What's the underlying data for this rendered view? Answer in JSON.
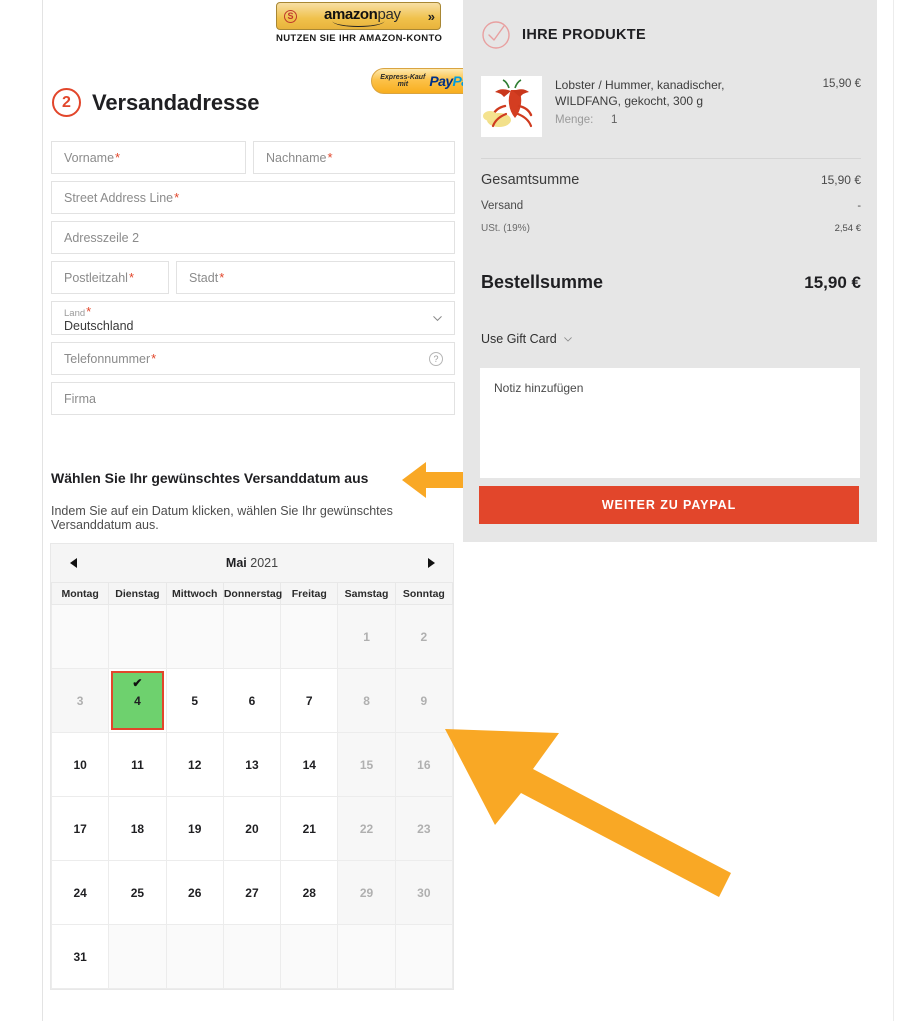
{
  "express": {
    "amazon": {
      "brand_amazon": "amazon",
      "brand_pay": "pay",
      "s_badge": "S",
      "chevron": "»",
      "subtitle": "NUTZEN SIE IHR AMAZON-KONTO"
    },
    "paypal": {
      "line1": "Express-Kauf",
      "line2": "mit",
      "logo_a": "Pay",
      "logo_b": "Pal"
    }
  },
  "step": {
    "number": "2",
    "title": "Versandadresse",
    "accent": "#e2462b"
  },
  "form": {
    "fields": [
      {
        "label": "Vorname",
        "required": true
      },
      {
        "label": "Nachname",
        "required": true
      },
      {
        "label": "Street Address Line",
        "required": true
      },
      {
        "label": "Adresszeile 2",
        "required": false
      },
      {
        "label": "Postleitzahl",
        "required": true
      },
      {
        "label": "Stadt",
        "required": true
      },
      {
        "label": "Telefonnummer",
        "required": true
      },
      {
        "label": "Firma",
        "required": false
      }
    ],
    "country": {
      "label": "Land",
      "required_mark": "*",
      "value": "Deutschland"
    },
    "required_mark": "*",
    "help_glyph": "?"
  },
  "shipping_date": {
    "title": "Wählen Sie Ihr gewünschtes Versanddatum aus",
    "subtitle": "Indem Sie auf ein Datum klicken, wählen Sie Ihr gewünschtes Versanddatum aus."
  },
  "calendar": {
    "month": "Mai",
    "year": "2021",
    "prev_label": "◄",
    "next_label": "►",
    "weekdays": [
      "Montag",
      "Dienstag",
      "Mittwoch",
      "Donnerstag",
      "Freitag",
      "Samstag",
      "Sonntag"
    ],
    "selected_day": "4",
    "selected_check": "✔",
    "selected_bg": "#6ed16e",
    "selected_border": "#e2462b",
    "weeks": [
      [
        {
          "day": "",
          "state": "empty"
        },
        {
          "day": "",
          "state": "empty"
        },
        {
          "day": "",
          "state": "empty"
        },
        {
          "day": "",
          "state": "empty"
        },
        {
          "day": "",
          "state": "empty"
        },
        {
          "day": "1",
          "state": "disabled"
        },
        {
          "day": "2",
          "state": "disabled"
        }
      ],
      [
        {
          "day": "3",
          "state": "disabled"
        },
        {
          "day": "4",
          "state": "selected"
        },
        {
          "day": "5",
          "state": "available"
        },
        {
          "day": "6",
          "state": "available"
        },
        {
          "day": "7",
          "state": "available"
        },
        {
          "day": "8",
          "state": "disabled"
        },
        {
          "day": "9",
          "state": "disabled"
        }
      ],
      [
        {
          "day": "10",
          "state": "available"
        },
        {
          "day": "11",
          "state": "available"
        },
        {
          "day": "12",
          "state": "available"
        },
        {
          "day": "13",
          "state": "available"
        },
        {
          "day": "14",
          "state": "available"
        },
        {
          "day": "15",
          "state": "disabled"
        },
        {
          "day": "16",
          "state": "disabled"
        }
      ],
      [
        {
          "day": "17",
          "state": "available"
        },
        {
          "day": "18",
          "state": "available"
        },
        {
          "day": "19",
          "state": "available"
        },
        {
          "day": "20",
          "state": "available"
        },
        {
          "day": "21",
          "state": "available"
        },
        {
          "day": "22",
          "state": "disabled"
        },
        {
          "day": "23",
          "state": "disabled"
        }
      ],
      [
        {
          "day": "24",
          "state": "available"
        },
        {
          "day": "25",
          "state": "available"
        },
        {
          "day": "26",
          "state": "available"
        },
        {
          "day": "27",
          "state": "available"
        },
        {
          "day": "28",
          "state": "available"
        },
        {
          "day": "29",
          "state": "disabled"
        },
        {
          "day": "30",
          "state": "disabled"
        }
      ],
      [
        {
          "day": "31",
          "state": "available"
        },
        {
          "day": "",
          "state": "empty"
        },
        {
          "day": "",
          "state": "empty"
        },
        {
          "day": "",
          "state": "empty"
        },
        {
          "day": "",
          "state": "empty"
        },
        {
          "day": "",
          "state": "empty"
        },
        {
          "day": "",
          "state": "empty"
        }
      ]
    ]
  },
  "annotations": {
    "arrow_color": "#f9a825",
    "arrow_small_direction": "left",
    "arrow_big_direction": "up-left"
  },
  "sidebar": {
    "header_title": "IHRE PRODUKTE",
    "header_icon": "check-circle",
    "header_icon_color": "#e8a0a0",
    "product": {
      "name": "Lobster / Hummer, kanadischer, WILDFANG, gekocht, 300 g",
      "qty_label": "Menge:",
      "qty_value": "1",
      "price": "15,90 €",
      "thumb": "lobster-photo"
    },
    "totals": [
      {
        "label": "Gesamtsumme",
        "value": "15,90 €"
      },
      {
        "label": "Versand",
        "value": "-"
      },
      {
        "label": "USt. (19%)",
        "value": "2,54 €"
      }
    ],
    "grand_total": {
      "label": "Bestellsumme",
      "value": "15,90 €"
    },
    "gift_card": {
      "label": "Use Gift Card"
    },
    "note_placeholder": "Notiz hinzufügen",
    "cta_label": "WEITER ZU PAYPAL",
    "cta_color": "#e2462b",
    "bg_color": "#e6e6e6"
  }
}
